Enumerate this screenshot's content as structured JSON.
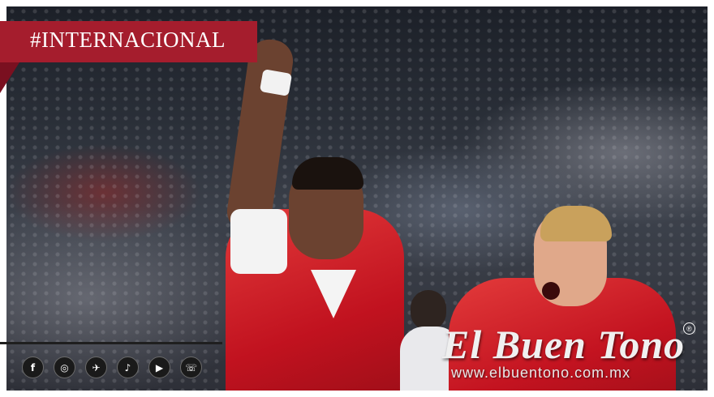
{
  "category_tag": "#INTERNACIONAL",
  "photo": {
    "description_icon": "photo-image"
  },
  "social_icons": [
    {
      "name": "facebook-icon",
      "glyph": "f"
    },
    {
      "name": "instagram-icon",
      "glyph": "◎"
    },
    {
      "name": "twitter-icon",
      "glyph": "✈"
    },
    {
      "name": "tiktok-icon",
      "glyph": "♪"
    },
    {
      "name": "youtube-icon",
      "glyph": "▶"
    },
    {
      "name": "whatsapp-icon",
      "glyph": "☏"
    }
  ],
  "brand": {
    "name": "El Buen Tono",
    "registered": "®",
    "url": "www.elbuentono.com.mx"
  },
  "colors": {
    "tag_bg": "#a51d2d",
    "tag_fold": "#7a1020",
    "jersey_red": "#c1121f"
  }
}
